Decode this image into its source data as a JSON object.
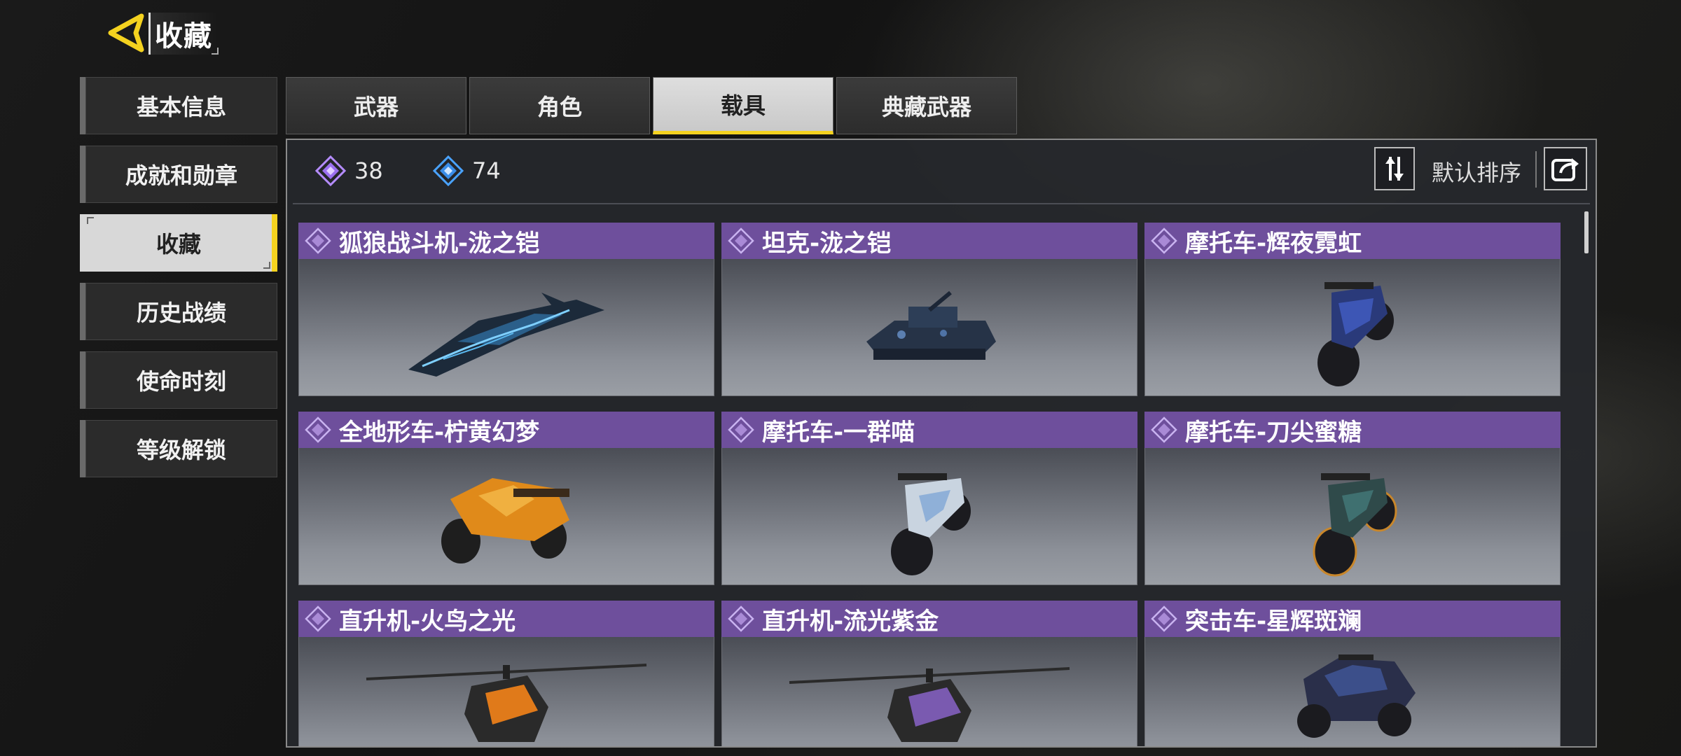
{
  "header": {
    "title": "收藏",
    "back_icon": "back-arrow-icon",
    "accent": "#f4d21f"
  },
  "sidebar": {
    "items": [
      {
        "label": "基本信息",
        "active": false
      },
      {
        "label": "成就和勋章",
        "active": false
      },
      {
        "label": "收藏",
        "active": true
      },
      {
        "label": "历史战绩",
        "active": false
      },
      {
        "label": "使命时刻",
        "active": false
      },
      {
        "label": "等级解锁",
        "active": false
      }
    ]
  },
  "tabs": [
    {
      "label": "武器",
      "active": false
    },
    {
      "label": "角色",
      "active": false
    },
    {
      "label": "载具",
      "active": true
    },
    {
      "label": "典藏武器",
      "active": false
    }
  ],
  "stats": {
    "purple_count": "38",
    "blue_count": "74",
    "purple_color": "#b58cff",
    "blue_color": "#4aa3ff"
  },
  "sort": {
    "label": "默认排序",
    "icon": "sort-icon",
    "share_icon": "share-icon"
  },
  "cards": [
    {
      "name": "狐狼战斗机-泷之铠",
      "vehicle": "jet",
      "rarity_color": "#6e4f9c"
    },
    {
      "name": "坦克-泷之铠",
      "vehicle": "tank",
      "rarity_color": "#6e4f9c"
    },
    {
      "name": "摩托车-辉夜霓虹",
      "vehicle": "motorcycle",
      "rarity_color": "#6e4f9c"
    },
    {
      "name": "全地形车-柠黄幻梦",
      "vehicle": "atv",
      "rarity_color": "#6e4f9c"
    },
    {
      "name": "摩托车-一群喵",
      "vehicle": "motorcycle",
      "rarity_color": "#6e4f9c"
    },
    {
      "name": "摩托车-刀尖蜜糖",
      "vehicle": "motorcycle",
      "rarity_color": "#6e4f9c"
    },
    {
      "name": "直升机-火鸟之光",
      "vehicle": "helicopter",
      "rarity_color": "#6e4f9c"
    },
    {
      "name": "直升机-流光紫金",
      "vehicle": "helicopter",
      "rarity_color": "#6e4f9c"
    },
    {
      "name": "突击车-星辉斑斓",
      "vehicle": "buggy",
      "rarity_color": "#6e4f9c"
    }
  ]
}
